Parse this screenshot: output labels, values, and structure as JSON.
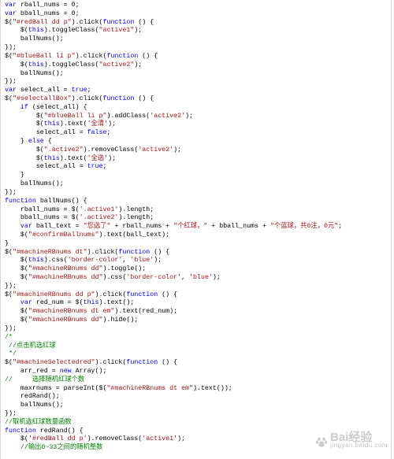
{
  "editor": {
    "lines": [
      "var rball_nums = 0;",
      "var bball_nums = 0;",
      "$(\"#redBall dd p\").click(function () {",
      "    $(this).toggleClass(\"active1\");",
      "    ballNums();",
      "});",
      "$(\"#blueBall li p\").click(function () {",
      "    $(this).toggleClass(\"active2\");",
      "    ballNums();",
      "});",
      "var select_all = true;",
      "$(\"#selectallBox\").click(function () {",
      "    if (select_all) {",
      "        $(\"#blueBall li p\").addClass('active2');",
      "        $(this).text('全清');",
      "        select_all = false;",
      "    } else {",
      "        $(\".active2\").removeClass('active2');",
      "        $(this).text('全选');",
      "        select_all = true;",
      "    }",
      "    ballNums();",
      "});",
      "function ballNums() {",
      "    rball_nums = $('.active1').length;",
      "    bball_nums = $('.active2').length;",
      "    var ball_text = \"您选了\" + rball_nums + \"个红球，\" + bball_nums + \"个蓝球，共0注，0元\";",
      "    $(\"#confirmBallnums\").text(ball_text);",
      "}",
      "$(\"#machineRBnums dt\").click(function () {",
      "    $(this).css('border-color', 'blue');",
      "    $(\"#machineRBnums dd\").toggle();",
      "    $(\"#machineRBnums dd\").css('border-color', 'blue');",
      "});",
      "$(\"#machineRBnums dd p\").click(function () {",
      "    var red_num = $(this).text();",
      "    $(\"#machineRBnums dt em\").text(red_num);",
      "    $(\"#machineRBnums dd\").hide();",
      "});",
      "/*",
      " //点击机选红球",
      " */",
      "$(\"#machineSelectedred\").click(function () {",
      "    arr_red = new Array();",
      "//     选择随机红球个数",
      "    maxrnums = parseInt($(\"#machineRBnums dt em\").text());",
      "    redRand();",
      "    ballNums();",
      "});",
      "//取机选红球数量函数",
      "function redRand() {",
      "    $('#redBall dd p').removeClass('active1');",
      "    //输出0~33之间的随机整数"
    ]
  },
  "watermark": {
    "main": "Bai经验",
    "sub": "jingyan.baidu.com"
  },
  "colors": {
    "keyword": "#0000ff",
    "string": "#a31515",
    "comment": "#008000",
    "text": "#000000",
    "background": "#ffffff"
  }
}
